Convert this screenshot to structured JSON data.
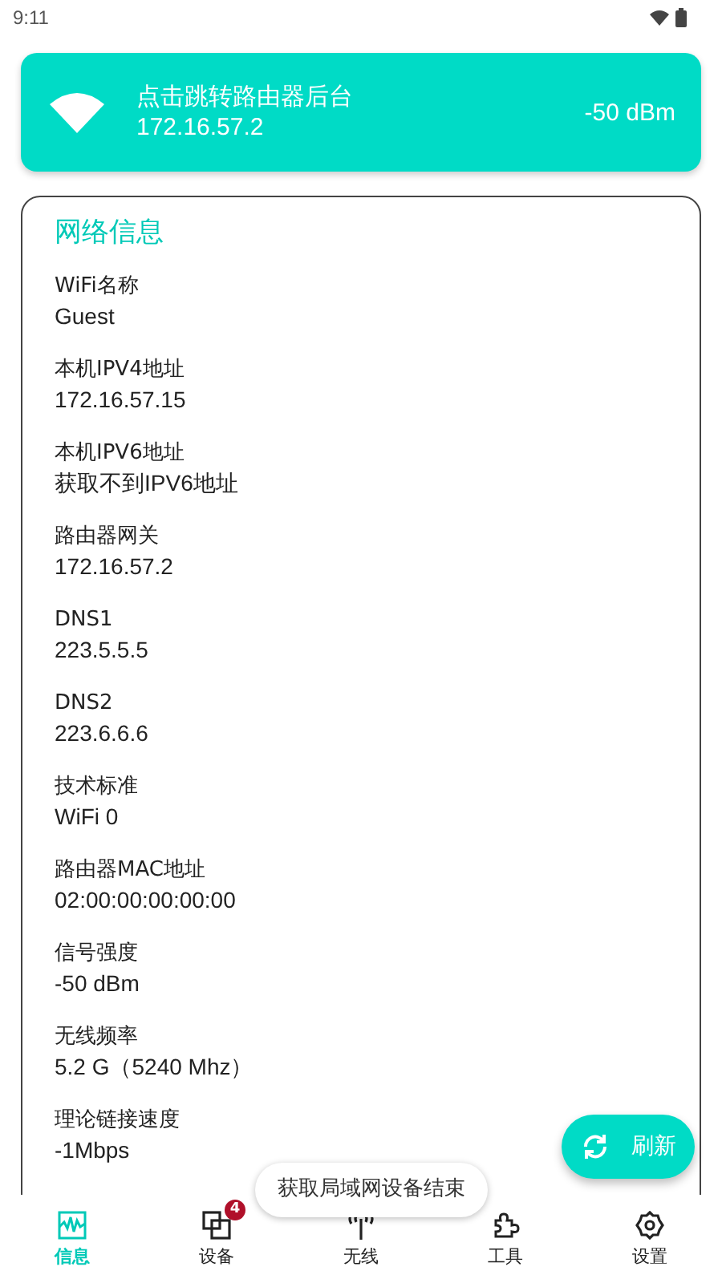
{
  "status_bar": {
    "time": "9:11"
  },
  "banner": {
    "title": "点击跳转路由器后台",
    "ip": "172.16.57.2",
    "signal": "-50 dBm"
  },
  "card": {
    "title": "网络信息",
    "items": [
      {
        "label": "WiFi名称",
        "value": "Guest"
      },
      {
        "label": "本机IPV4地址",
        "value": "172.16.57.15"
      },
      {
        "label": "本机IPV6地址",
        "value": "获取不到IPV6地址"
      },
      {
        "label": "路由器网关",
        "value": "172.16.57.2"
      },
      {
        "label": "DNS1",
        "value": "223.5.5.5"
      },
      {
        "label": "DNS2",
        "value": "223.6.6.6"
      },
      {
        "label": "技术标准",
        "value": "WiFi 0"
      },
      {
        "label": "路由器MAC地址",
        "value": "02:00:00:00:00:00"
      },
      {
        "label": "信号强度",
        "value": "-50 dBm"
      },
      {
        "label": "无线频率",
        "value": "5.2 G（5240 Mhz）"
      },
      {
        "label": "理论链接速度",
        "value": "-1Mbps"
      }
    ]
  },
  "fab": {
    "label": "刷新"
  },
  "toast": "获取局域网设备结束",
  "nav": [
    {
      "kind": "info",
      "label": "信息",
      "selected": true
    },
    {
      "kind": "devices",
      "label": "设备",
      "selected": false,
      "badge": "4"
    },
    {
      "kind": "wireless",
      "label": "无线",
      "selected": false
    },
    {
      "kind": "tools",
      "label": "工具",
      "selected": false
    },
    {
      "kind": "settings",
      "label": "设置",
      "selected": false
    }
  ]
}
